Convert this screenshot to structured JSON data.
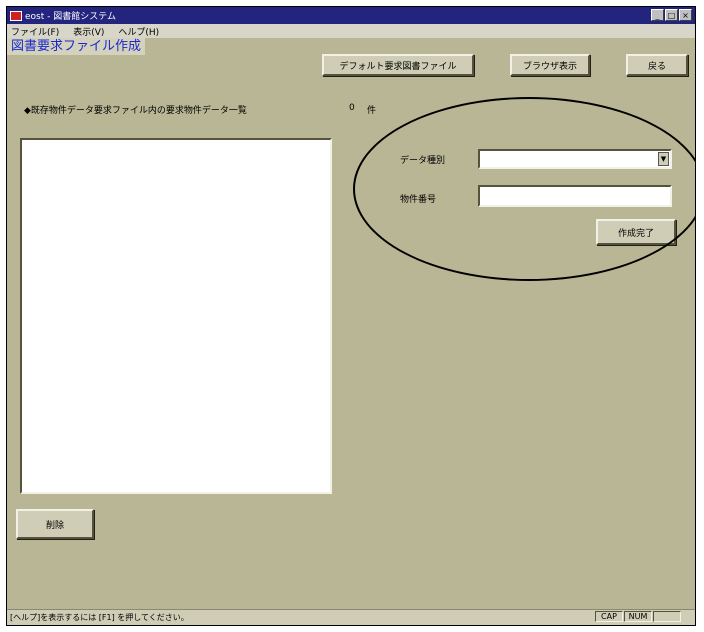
{
  "window": {
    "title": "eost - 図書館システム",
    "controls": [
      "_",
      "□",
      "×"
    ]
  },
  "menu": [
    "ファイル(F)",
    "表示(V)",
    "ヘルプ(H)"
  ],
  "page_title": "図書要求ファイル作成",
  "toolbar": {
    "default_button": "デフォルト要求図書ファイル",
    "browse_button": "ブラウザ表示",
    "back_button": "戻る"
  },
  "list": {
    "header": "◆既存物件データ要求ファイル内の要求物件データ一覧",
    "count": "0",
    "count_unit": "件",
    "items": []
  },
  "form": {
    "data_type_label": "データ種別",
    "data_type_value": "",
    "item_no_label": "物件番号",
    "item_no_value": "",
    "create_button": "作成完了"
  },
  "delete_button": "削除",
  "status": {
    "message": "[ヘルプ]を表示するには [F1] を押してください。",
    "caps": "CAP",
    "num": "NUM"
  },
  "colors": {
    "window_bg": "#b8b694",
    "titlebar": "#23247e",
    "page_title_text": "#1a2ad0"
  }
}
